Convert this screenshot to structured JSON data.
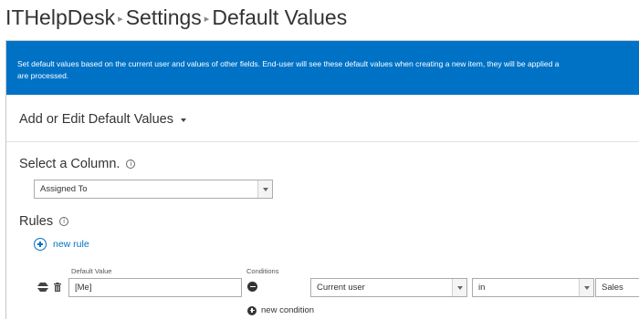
{
  "breadcrumb": {
    "site": "ITHelpDesk",
    "settings": "Settings",
    "page": "Default Values"
  },
  "banner": {
    "line1": "Set default values based on the current user and values of other fields. End-user will see these default values when creating a new item, they will be applied a",
    "line2": "are processed."
  },
  "section": {
    "title": "Add or Edit Default Values"
  },
  "column_select": {
    "label": "Select a Column.",
    "value": "Assigned To"
  },
  "rules": {
    "label": "Rules",
    "new_rule": "new rule",
    "default_value_header": "Default Value",
    "conditions_header": "Conditions",
    "items": [
      {
        "default_value": "[Me]",
        "condition_field": "Current user",
        "condition_operator": "in",
        "condition_value": "Sales"
      }
    ],
    "new_condition": "new condition"
  },
  "colors": {
    "banner_bg": "#0072c6",
    "link": "#0072c6"
  }
}
